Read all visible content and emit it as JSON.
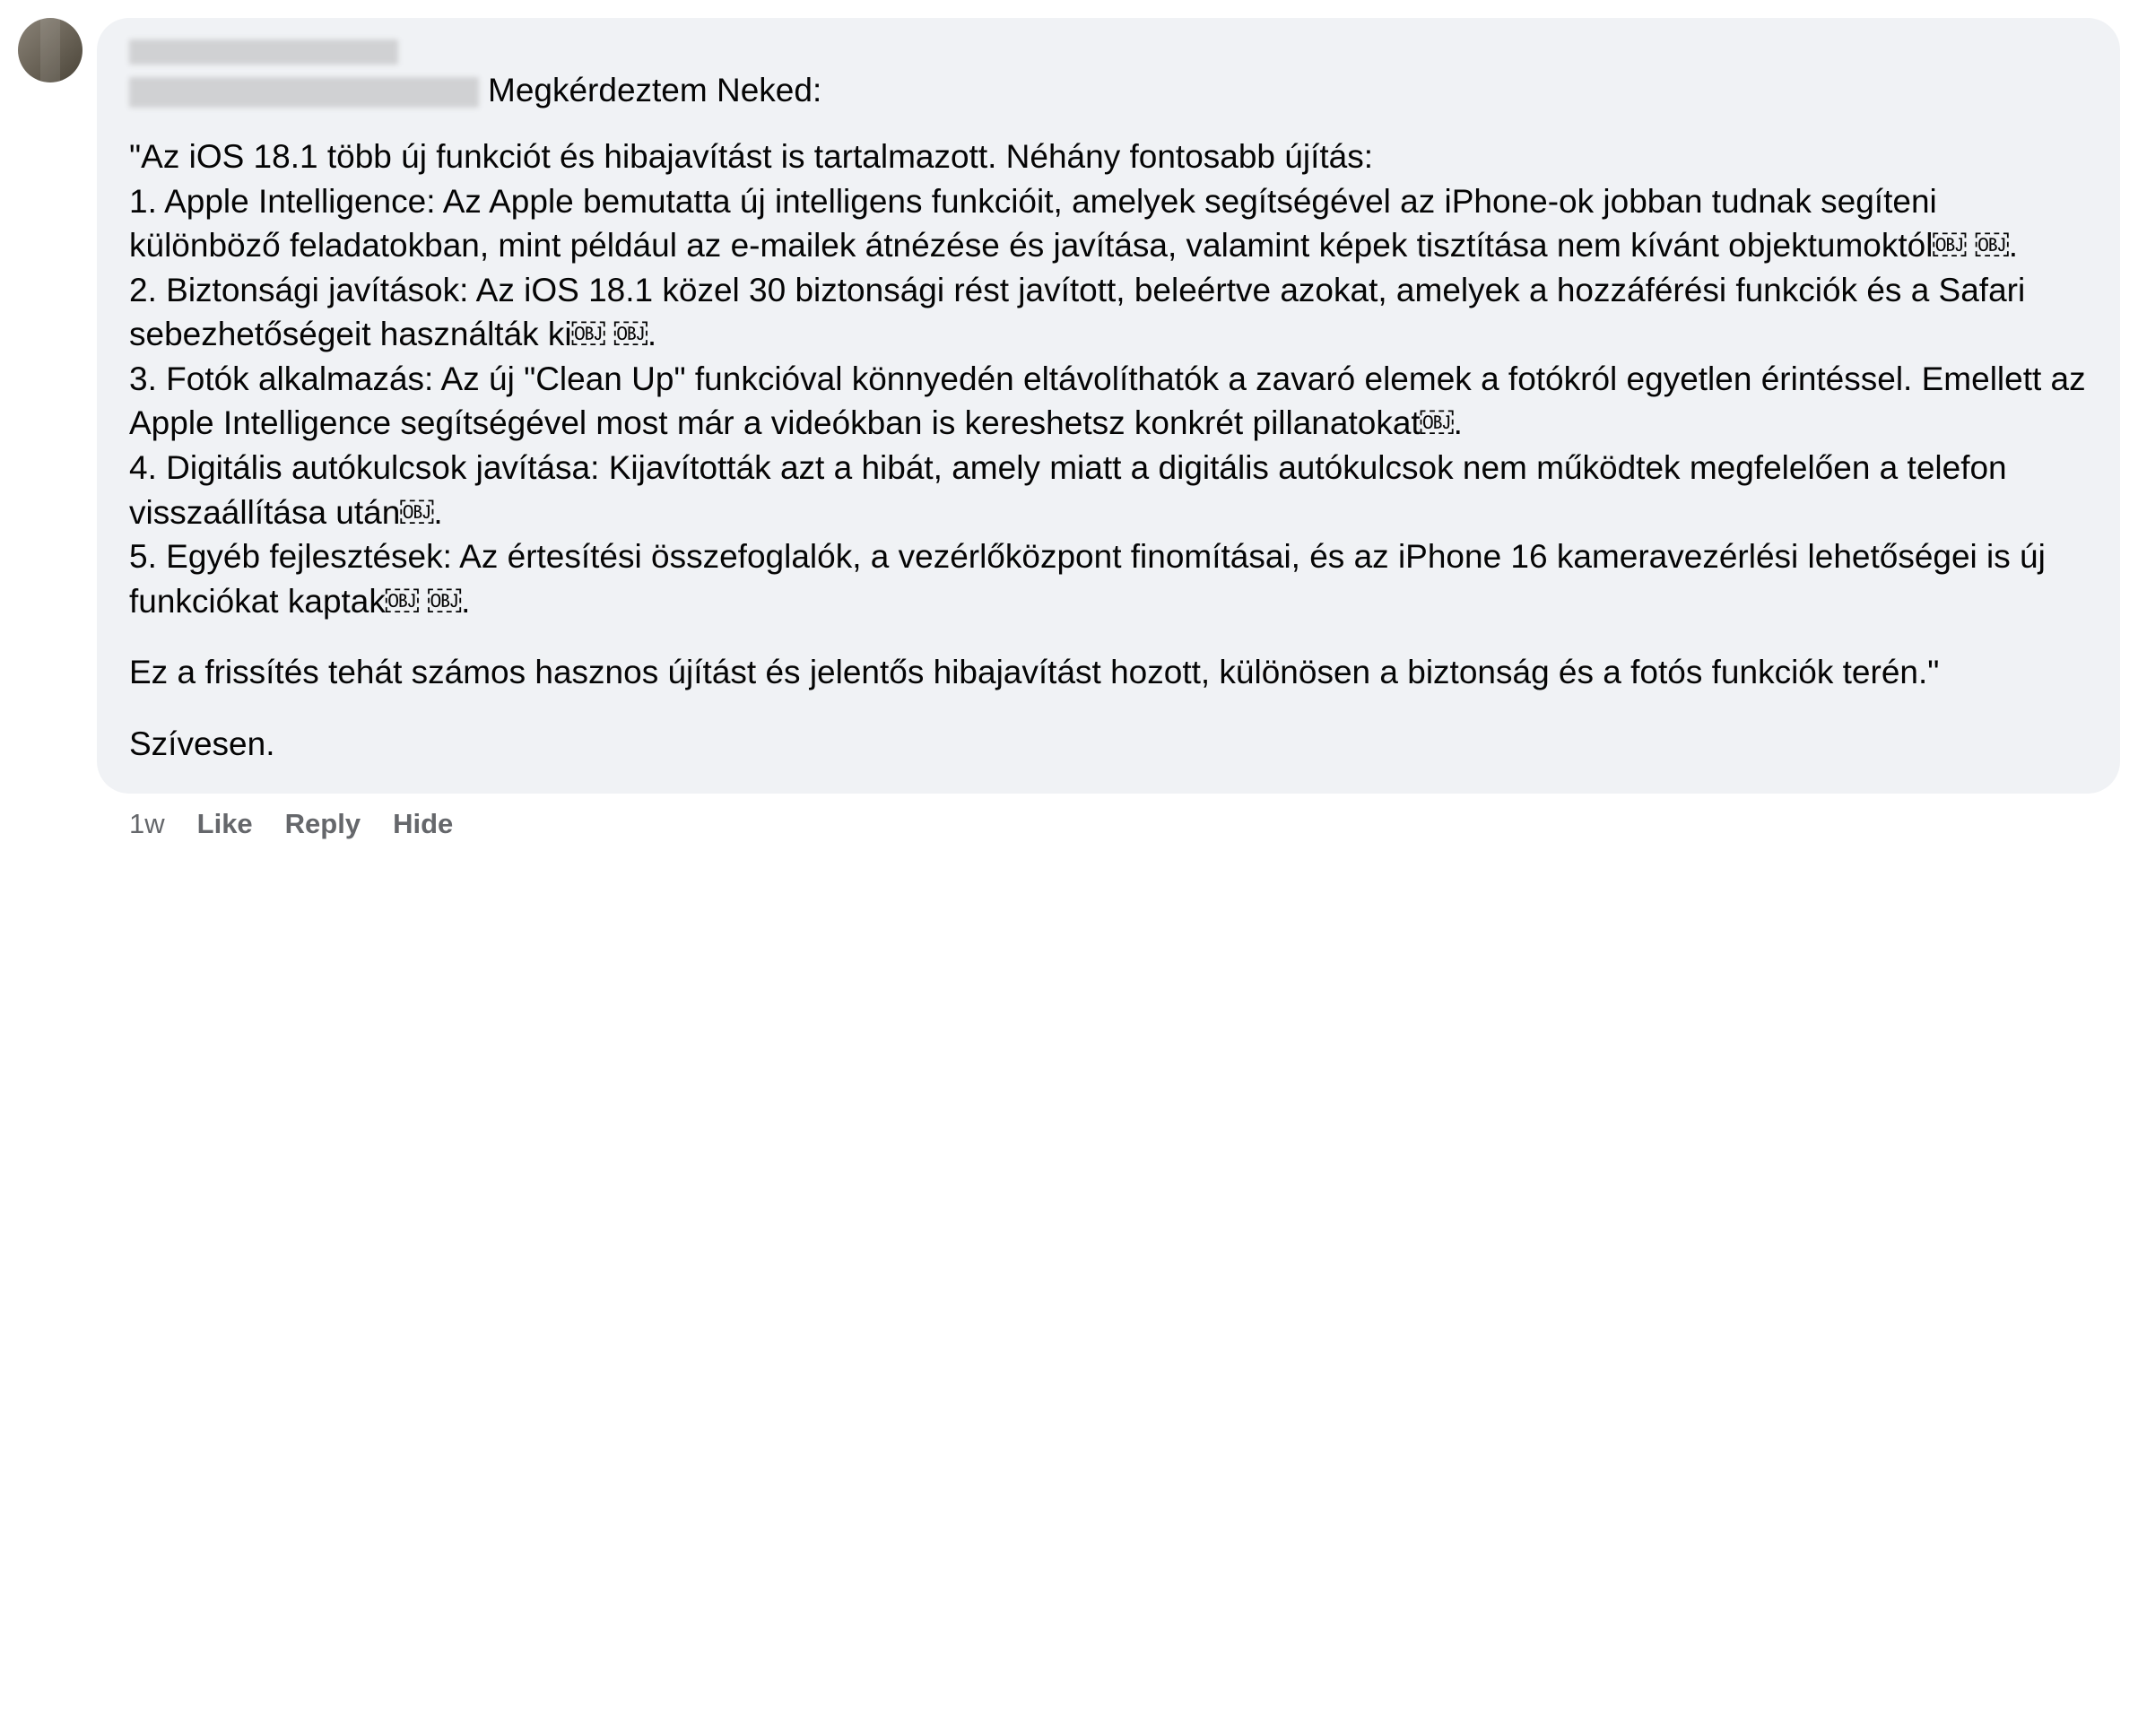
{
  "comment": {
    "intro": "Megkérdeztem Neked:",
    "body_main": "\"Az iOS 18.1 több új funkciót és hibajavítást is tartalmazott. Néhány fontosabb újítás:\n1. Apple Intelligence: Az Apple bemutatta új intelligens funkcióit, amelyek segítségével az iPhone-ok jobban tudnak segíteni különböző feladatokban, mint például az e-mailek átnézése és javítása, valamint képek tisztítása nem kívánt objektumoktól￼ ￼.\n2. Biztonsági javítások: Az iOS 18.1 közel 30 biztonsági rést javított, beleértve azokat, amelyek a hozzáférési funkciók és a Safari sebezhetőségeit használták ki￼ ￼.\n3. Fotók alkalmazás: Az új \"Clean Up\" funkcióval könnyedén eltávolíthatók a zavaró elemek a fotókról egyetlen érintéssel. Emellett az Apple Intelligence segítségével most már a videókban is kereshetsz konkrét pillanatokat￼.\n4. Digitális autókulcsok javítása: Kijavították azt a hibát, amely miatt a digitális autókulcsok nem működtek megfelelően a telefon visszaállítása után￼.\n5. Egyéb fejlesztések: Az értesítési összefoglalók, a vezérlőközpont finomításai, és az iPhone 16 kameravezérlési lehetőségei is új funkciókat kaptak￼ ￼.",
    "body_summary": "Ez a frissítés tehát számos hasznos újítást és jelentős hibajavítást hozott, különösen a biztonság és a fotós funkciók terén.\"",
    "body_signoff": "Szívesen."
  },
  "actions": {
    "timestamp": "1w",
    "like": "Like",
    "reply": "Reply",
    "hide": "Hide"
  }
}
